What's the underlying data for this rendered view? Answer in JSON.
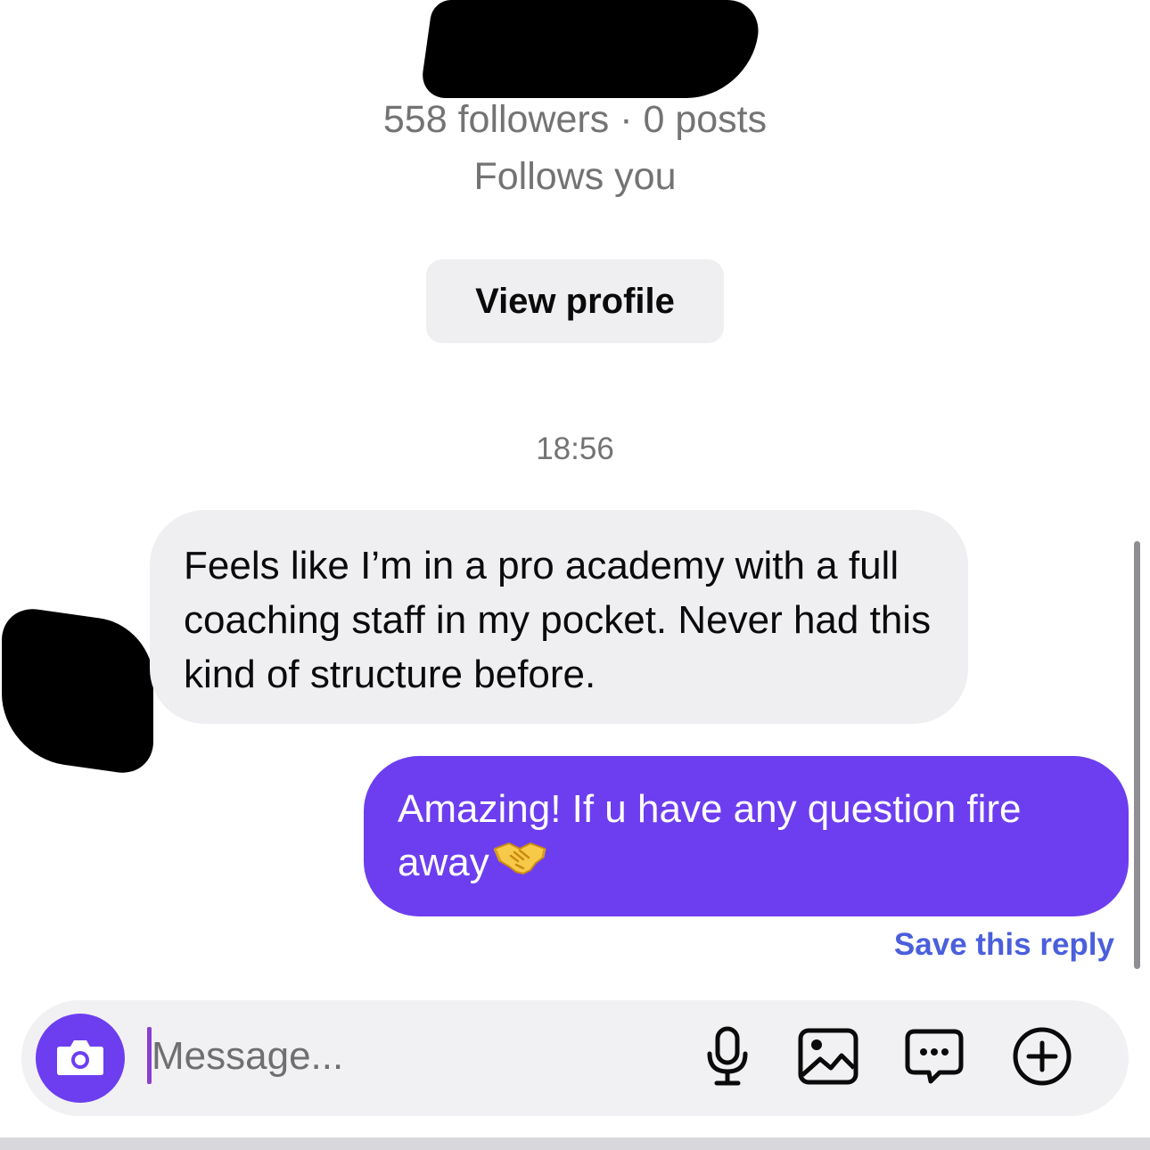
{
  "profile": {
    "stats": "558 followers · 0 posts",
    "follows_you": "Follows you",
    "view_profile_label": "View profile"
  },
  "thread": {
    "timestamp": "18:56",
    "messages": [
      {
        "direction": "incoming",
        "text": "Feels like I’m in a pro academy with a full coaching staff in my pocket. Never had this kind of structure before."
      },
      {
        "direction": "outgoing",
        "text": "Amazing! If u have any question fire away",
        "emoji": "handshake"
      }
    ],
    "save_reply_label": "Save this reply"
  },
  "composer": {
    "placeholder": "Message...",
    "value": "",
    "icons": [
      "camera-icon",
      "microphone-icon",
      "gallery-icon",
      "sticker-icon",
      "plus-icon"
    ]
  },
  "colors": {
    "accent": "#6d3ef0",
    "link": "#4a5fdc",
    "bubble_incoming": "#efeff2",
    "muted_text": "#737373"
  }
}
